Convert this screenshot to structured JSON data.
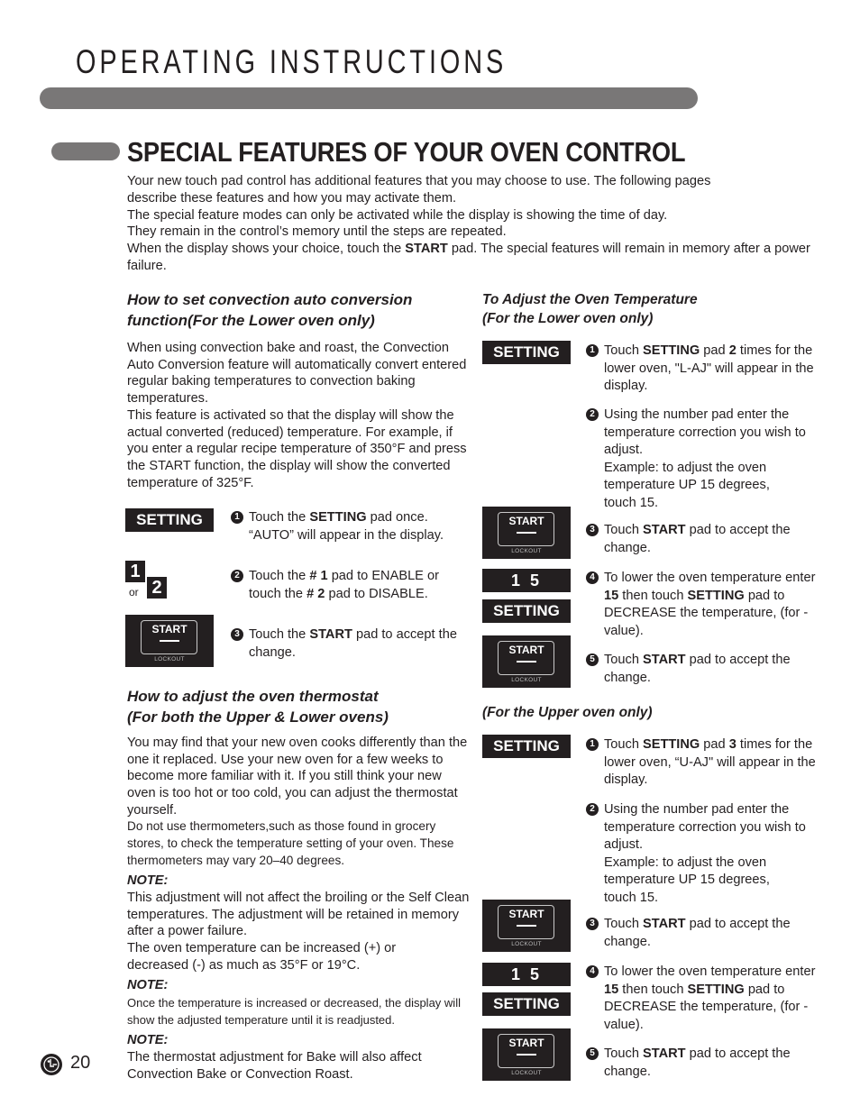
{
  "header": {
    "title": "OPERATING INSTRUCTIONS"
  },
  "section": {
    "title": "SPECIAL FEATURES OF YOUR OVEN CONTROL"
  },
  "intro": {
    "line1": "Your new touch pad control has additional features that you may choose to use. The following pages describe these features and how you may activate them.",
    "line2": "The special feature modes can only be activated while the display is showing the time of day.",
    "line3": "They remain in the control’s memory until the steps are repeated.",
    "line4_pre": "When the display shows your choice, touch the ",
    "line4_bold": "START",
    "line4_post": " pad. The special features will remain in memory after a power failure."
  },
  "convection": {
    "heading": "How to set convection auto conversion function(For the Lower oven only)",
    "body1": "When using convection bake and roast, the Convection Auto Conversion feature will automatically convert entered regular baking temperatures to convection baking temperatures.",
    "body2": "This feature is activated so that the display will show the actual converted (reduced) temperature. For example, if you enter a regular recipe temperature of 350°F and press the START function, the display will show the converted temperature of 325°F.",
    "pads": {
      "setting": "SETTING",
      "digit1": "1",
      "or": "or",
      "digit2": "2",
      "start": "START",
      "lockout": "LOCKOUT"
    },
    "steps": [
      {
        "num": "1",
        "pre": "Touch the ",
        "bold": "SETTING",
        "post": " pad once. “AUTO” will appear in the display."
      },
      {
        "num": "2",
        "pre": "Touch the ",
        "bold": "# 1",
        "mid": " pad to ENABLE or touch the ",
        "bold2": "# 2",
        "post": " pad to DISABLE."
      },
      {
        "num": "3",
        "pre": "Touch the ",
        "bold": "START",
        "post": " pad to accept the change."
      }
    ]
  },
  "thermostat": {
    "heading_line1": "How to adjust the oven thermostat",
    "heading_line2": "(For both the Upper & Lower ovens)",
    "body1": "You may find that your new oven cooks differently than the one it replaced. Use your new oven for a few weeks to become more familiar with it. If you still think your new oven is too hot or too cold, you can adjust the thermostat yourself.",
    "body2": "Do not use thermometers,such as those found in grocery stores, to check the temperature setting of your oven. These thermometers may vary 20–40 degrees.",
    "note1_label": "NOTE:",
    "note1_text_a": "This adjustment will not affect the broiling or the Self Clean temperatures. The adjustment will be retained in memory after a power failure.",
    "note1_text_b": "The oven temperature can be increased (+) or decreased (-) as much as 35°F or 19°C.",
    "note2_label": "NOTE:",
    "note2_text": "Once the temperature is increased or decreased, the display will show the adjusted temperature until it is readjusted.",
    "note3_label": "NOTE:",
    "note3_text": "The thermostat adjustment for Bake will also affect Convection Bake or Convection Roast."
  },
  "adjust_lower": {
    "heading_line1": "To Adjust the Oven Temperature",
    "heading_line2": "(For the Lower oven only)",
    "pads": {
      "setting": "SETTING",
      "start": "START",
      "lockout": "LOCKOUT",
      "num": "1 5"
    },
    "steps": [
      {
        "num": "1",
        "pre": "Touch ",
        "bold": "SETTING",
        "mid": " pad ",
        "bold2": "2",
        "post": " times for the lower oven,  \"L-AJ\" will appear in the display."
      },
      {
        "num": "2",
        "text": "Using the number pad enter the temperature correction you wish to adjust.",
        "example": "Example: to adjust the oven temperature UP 15 degrees, touch 15."
      },
      {
        "num": "3",
        "pre": "Touch ",
        "bold": "START",
        "post": " pad to accept the change."
      },
      {
        "num": "4",
        "pre": "To lower the oven temperature enter ",
        "bold": "15",
        "mid": " then touch ",
        "bold2": "SETTING",
        "post": " pad to DECREASE the temperature, (for - value)."
      },
      {
        "num": "5",
        "pre": "Touch ",
        "bold": "START",
        "post": " pad to accept the change."
      }
    ]
  },
  "adjust_upper": {
    "heading": "(For the Upper oven only)",
    "pads": {
      "setting": "SETTING",
      "start": "START",
      "lockout": "LOCKOUT",
      "num": "1 5"
    },
    "steps": [
      {
        "num": "1",
        "pre": "Touch ",
        "bold": "SETTING",
        "mid": " pad ",
        "bold2": "3",
        "post": " times for the lower oven,  “U-AJ\" will appear in the display."
      },
      {
        "num": "2",
        "text": "Using the number pad enter the temperature correction you wish to adjust.",
        "example": "Example: to adjust the oven temperature UP 15 degrees, touch 15."
      },
      {
        "num": "3",
        "pre": "Touch ",
        "bold": "START",
        "post": " pad to accept the change."
      },
      {
        "num": "4",
        "pre": "To lower the oven temperature enter ",
        "bold": "15",
        "mid": " then touch ",
        "bold2": "SETTING",
        "post": " pad to DECREASE the temperature, (for - value)."
      },
      {
        "num": "5",
        "pre": "Touch ",
        "bold": "START",
        "post": " pad to accept the change."
      }
    ]
  },
  "footer": {
    "logo": "lg-logo-icon",
    "page_number": "20"
  }
}
